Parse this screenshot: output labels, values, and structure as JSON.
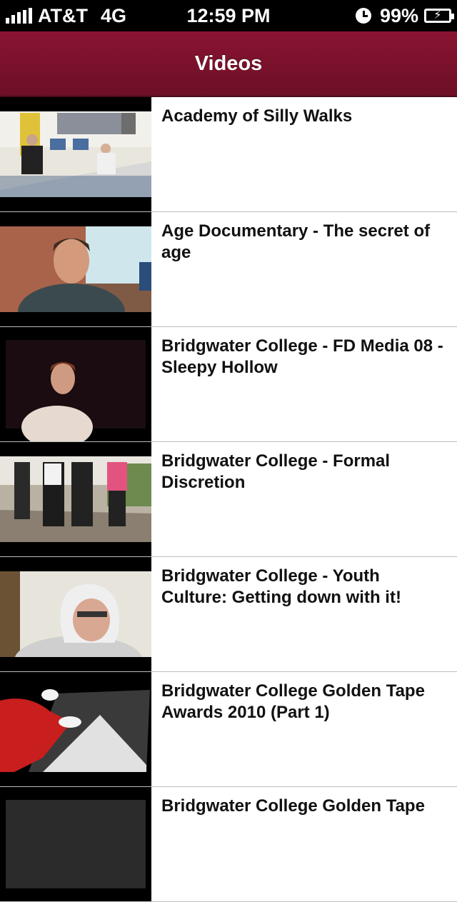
{
  "status_bar": {
    "carrier": "AT&T",
    "network": "4G",
    "time": "12:59 PM",
    "battery": "99%"
  },
  "nav": {
    "title": "Videos"
  },
  "videos": [
    {
      "title": "Academy of Silly Walks"
    },
    {
      "title": "Age Documentary - The secret of age"
    },
    {
      "title": "Bridgwater College - FD Media 08 - Sleepy Hollow"
    },
    {
      "title": "Bridgwater College - Formal Discretion"
    },
    {
      "title": "Bridgwater College - Youth Culture: Getting down with it!"
    },
    {
      "title": "Bridgwater College Golden Tape Awards 2010 (Part 1)"
    },
    {
      "title": "Bridgwater College Golden Tape"
    }
  ]
}
